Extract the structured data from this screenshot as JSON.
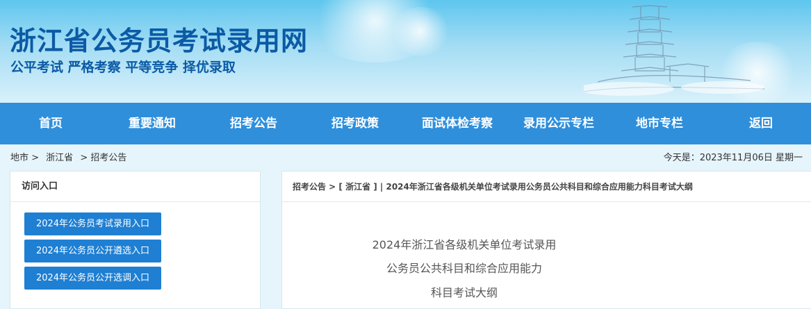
{
  "header": {
    "site_title": "浙江省公务员考试录用网",
    "slogan": "公平考试 严格考察 平等竞争 择优录取"
  },
  "nav": {
    "items": [
      "首页",
      "重要通知",
      "招考公告",
      "招考政策",
      "面试体检考察",
      "录用公示专栏",
      "地市专栏",
      "返回"
    ]
  },
  "breadcrumb": {
    "items": [
      "地市 >",
      "浙江省",
      "> 招考公告"
    ]
  },
  "date_text": "今天是：2023年11月06日 星期一",
  "sidebar": {
    "title": "访问入口",
    "buttons": [
      "2024年公务员考试录用入口",
      "2024年公务员公开遴选入口",
      "2024年公务员公开选调入口"
    ]
  },
  "article": {
    "path": "招考公告 > [ 浙江省 ] | 2024年浙江省各级机关单位考试录用公务员公共科目和综合应用能力科目考试大纲",
    "title_lines": [
      "2024年浙江省各级机关单位考试录用",
      "公务员公共科目和综合应用能力",
      "科目考试大纲"
    ]
  },
  "colors": {
    "brand": "#0b5aa5",
    "nav_bg": "#2f8fdb",
    "button_bg": "#1e7fd3",
    "page_bg": "#e6f4fb"
  }
}
